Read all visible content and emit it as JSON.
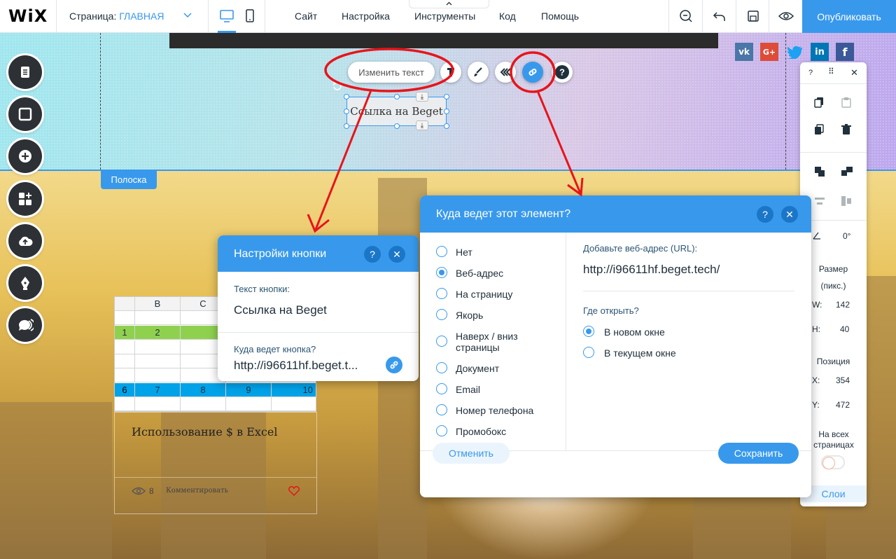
{
  "topbar": {
    "logo": "WiX",
    "page_label": "Страница:",
    "page_value": "ГЛАВНАЯ",
    "menu": [
      "Сайт",
      "Настройка",
      "Инструменты",
      "Код",
      "Помощь"
    ],
    "publish": "Опубликовать"
  },
  "canvas": {
    "strip_label": "Полоска",
    "change_text": "Изменить текст",
    "button_text": "Ссылка на Beget"
  },
  "sheet": {
    "header": [
      "",
      "B",
      "C"
    ],
    "green_row": [
      "1",
      "2"
    ],
    "blue_row": [
      "6",
      "7",
      "8",
      "9",
      "10"
    ]
  },
  "blog": {
    "title": "Использование $ в Excel",
    "views": "8",
    "comment": "Комментировать"
  },
  "button_settings": {
    "title": "Настройки кнопки",
    "text_label": "Текст кнопки:",
    "text_value": "Ссылка на Beget",
    "link_label": "Куда ведет кнопка?",
    "link_value": "http://i96611hf.beget.t..."
  },
  "link_dialog": {
    "title": "Куда ведет этот элемент?",
    "options": [
      "Нет",
      "Веб-адрес",
      "На страницу",
      "Якорь",
      "Наверх / вниз страницы",
      "Документ",
      "Email",
      "Номер телефона",
      "Промобокс"
    ],
    "selected": "Веб-адрес",
    "url_label": "Добавьте веб-адрес (URL):",
    "url_value": "http://i96611hf.beget.tech/",
    "open_label": "Где открыть?",
    "open_options": [
      "В новом окне",
      "В текущем окне"
    ],
    "open_selected": "В новом окне",
    "cancel": "Отменить",
    "save": "Сохранить"
  },
  "right_panel": {
    "rotation": "0°",
    "size_label": "Размер",
    "size_unit": "(пикс.)",
    "w_label": "W:",
    "w_value": "142",
    "h_label": "H:",
    "h_value": "40",
    "pos_label": "Позиция",
    "x_label": "X:",
    "x_value": "354",
    "y_label": "Y:",
    "y_value": "472",
    "all_pages": "На всех страницах",
    "layers": "Слои"
  },
  "colors": {
    "accent": "#3899ec",
    "annotation": "#e8141b",
    "green_row": "#8fd14f",
    "blue_row": "#00a2e8"
  }
}
